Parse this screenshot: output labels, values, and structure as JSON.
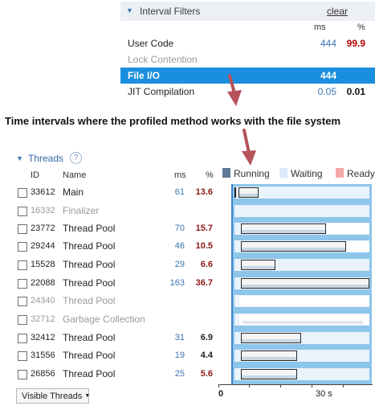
{
  "interval_filters": {
    "title": "Interval Filters",
    "clear_label": "clear",
    "col_ms": "ms",
    "col_pct": "%",
    "rows": [
      {
        "label": "User Code",
        "ms": "444",
        "pct": "99.9"
      },
      {
        "label": "Lock Contention",
        "ms": "",
        "pct": ""
      },
      {
        "label": "File I/O",
        "ms": "444",
        "pct": ""
      },
      {
        "label": "JIT Compilation",
        "ms": "0.05",
        "pct": "0.01"
      }
    ]
  },
  "annotation": "Time intervals where the profiled method works with the file system",
  "threads": {
    "title": "Threads",
    "help_label": "?",
    "col_id": "ID",
    "col_name": "Name",
    "col_ms": "ms",
    "col_pct": "%",
    "legend": [
      {
        "label": "Running",
        "color": "#5d7b98"
      },
      {
        "label": "Waiting",
        "color": "#dbe9f8"
      },
      {
        "label": "Ready",
        "color": "#f5a8a8"
      }
    ],
    "rows": [
      {
        "id": "33612",
        "name": "Main",
        "ms": "61",
        "pct": "13.6"
      },
      {
        "id": "16332",
        "name": "Finalizer",
        "ms": "",
        "pct": ""
      },
      {
        "id": "23772",
        "name": "Thread Pool",
        "ms": "70",
        "pct": "15.7"
      },
      {
        "id": "29244",
        "name": "Thread Pool",
        "ms": "46",
        "pct": "10.5"
      },
      {
        "id": "15528",
        "name": "Thread Pool",
        "ms": "29",
        "pct": "6.6"
      },
      {
        "id": "22088",
        "name": "Thread Pool",
        "ms": "163",
        "pct": "36.7"
      },
      {
        "id": "24340",
        "name": "Thread Pool",
        "ms": "",
        "pct": ""
      },
      {
        "id": "32712",
        "name": "Garbage Collection",
        "ms": "",
        "pct": ""
      },
      {
        "id": "32412",
        "name": "Thread Pool",
        "ms": "31",
        "pct": "6.9"
      },
      {
        "id": "31556",
        "name": "Thread Pool",
        "ms": "19",
        "pct": "4.4"
      },
      {
        "id": "26856",
        "name": "Thread Pool",
        "ms": "25",
        "pct": "5.6"
      }
    ],
    "axis": {
      "start_label": "0",
      "mid_label": "30 s"
    },
    "visible_threads_label": "Visible Threads"
  },
  "icons": {
    "collapse": "chevron-down-icon",
    "help": "help-icon",
    "dropdown": "caret-down-icon",
    "annotation_arrow": "red-arrow-icon"
  },
  "colors": {
    "selection": "#1a8fdf",
    "ms_value": "#3a74b5",
    "percent_value": "#b30000",
    "timeline_bg": "#8ec5ea",
    "arrow": "#b5525a"
  }
}
